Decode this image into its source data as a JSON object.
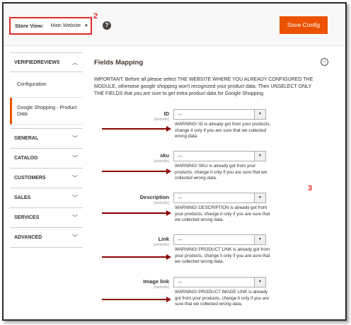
{
  "header": {
    "store_view_label": "Store View:",
    "store_view_value": "Main Website",
    "help_icon": "question-circle-icon",
    "save_label": "Save Config",
    "accent_color": "#eb5202"
  },
  "annotations": {
    "marker_2": "2",
    "marker_3": "3",
    "color": "#e02b27"
  },
  "sidebar": {
    "section_title": "VERIFIEDREVIEWS",
    "sub_items": [
      {
        "label": "Configuration"
      },
      {
        "label": "Google Shopping - Product Data"
      }
    ],
    "items": [
      {
        "label": "GENERAL"
      },
      {
        "label": "CATALOG"
      },
      {
        "label": "CUSTOMERS"
      },
      {
        "label": "SALES"
      },
      {
        "label": "SERVICES"
      },
      {
        "label": "ADVANCED"
      }
    ]
  },
  "main": {
    "section_title": "Fields Mapping",
    "important_text": "IMPORTANT: Before all please select THE WEBSITE WHERE YOU ALREADY CONFIGURED THE MODULE, otherwise google shopping won't recognized your product data. Then UNSELECT ONLY THE FIELDS that you are sure to get extra product data for Google Shopping.",
    "fields": [
      {
        "label": "ID",
        "scope": "[website]",
        "value": "---",
        "note": "WARNING! ID is already got from your products, change it only if you are sure that we collected wrong data."
      },
      {
        "label": "sku",
        "scope": "[website]",
        "value": "---",
        "note": "WARNING! SKU is already got from your products, change it only if you are sure that we collected wrong data."
      },
      {
        "label": "Description",
        "scope": "[website]",
        "value": "---",
        "note": "WARNING! DESCRIPTION is already got from your products, change it only if you are sure that we collected wrong data."
      },
      {
        "label": "Link",
        "scope": "[website]",
        "value": "---",
        "note": "WARNING! PRODUCT LINK is already got from your products, change it only if you are sure that we collected wrong data."
      },
      {
        "label": "Image link",
        "scope": "[website]",
        "value": "---",
        "note": "WARNING! PRODUCT IMAGE LINK is already got from your products, change it only if you are sure that we collected wrong data."
      }
    ]
  }
}
